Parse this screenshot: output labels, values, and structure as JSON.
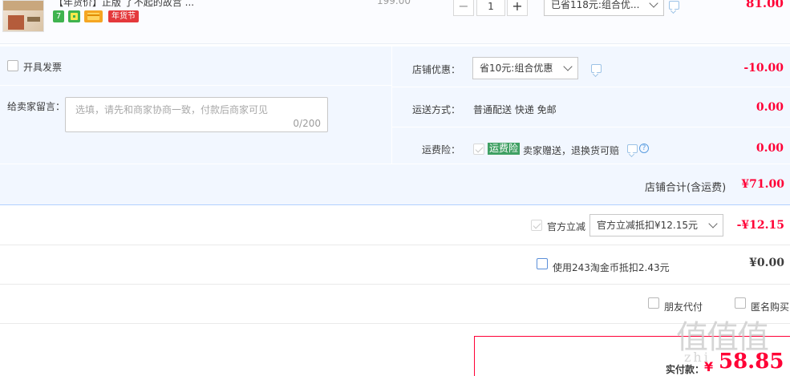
{
  "product": {
    "title": "【年货价】正版 了不起的故宫 ...",
    "badges": [
      "7",
      "",
      "",
      "年货节"
    ],
    "unit_price": "199.00",
    "qty_minus": "−",
    "qty_value": "1",
    "qty_plus": "+",
    "promo_select": "已省118元:组合优...",
    "subtotal": "81.00",
    "colors": {
      "badge_green": "#3fb34f",
      "badge_yellow": "#f5a623",
      "badge_red": "#e4393c"
    }
  },
  "shop": {
    "invoice_label": "开具发票",
    "memo_label": "给卖家留言：",
    "memo_placeholder": "选填，请先和商家协商一致，付款后商家可见",
    "memo_count": "0/200",
    "discount_label": "店铺优惠：",
    "discount_select": "省10元:组合优惠",
    "discount_amount": "-10.00",
    "shipping_label": "运送方式：",
    "shipping_value": "普通配送 快递 免邮",
    "shipping_amount": "0.00",
    "insurance_label": "运费险：",
    "insurance_tag": "运费险",
    "insurance_text": "卖家赠送，退换货可赔",
    "insurance_amount": "0.00",
    "total_label": "店铺合计(含运费)",
    "total_amount": "¥71.00"
  },
  "official": {
    "label": "官方立减",
    "select": "官方立减抵扣¥12.15元",
    "amount": "-¥12.15"
  },
  "coins": {
    "label": "使用243淘金币抵扣2.43元",
    "amount": "¥0.00"
  },
  "options": {
    "friend_pay": "朋友代付",
    "anonymous": "匿名购买"
  },
  "payment": {
    "label": "实付款：",
    "currency": "¥",
    "amount": "58.85"
  },
  "watermark": {
    "logo": "值值值",
    "site": "zhi"
  },
  "colors": {
    "accent_red": "#ff0036",
    "panel_bg": "#f2f7ff",
    "border_blue": "#b2d1ff"
  }
}
